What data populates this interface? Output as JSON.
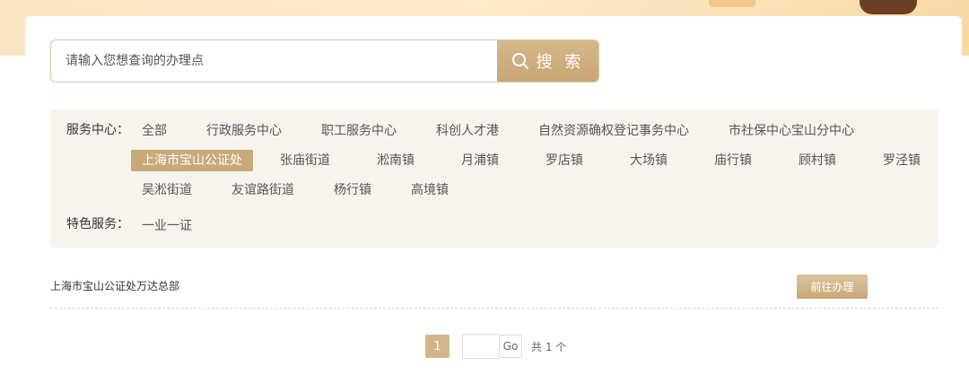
{
  "search": {
    "placeholder": "请输入您想查询的办理点",
    "button_label": "搜 索"
  },
  "filters": {
    "service_center": {
      "label": "服务中心：",
      "rows": [
        [
          "全部",
          "行政服务中心",
          "职工服务中心",
          "科创人才港",
          "自然资源确权登记事务中心",
          "市社保中心宝山分中心"
        ],
        [
          "上海市宝山公证处",
          "张庙街道",
          "淞南镇",
          "月浦镇",
          "罗店镇",
          "大场镇",
          "庙行镇",
          "顾村镇",
          "罗泾镇"
        ],
        [
          "吴淞街道",
          "友谊路街道",
          "杨行镇",
          "高境镇"
        ]
      ],
      "selected": "上海市宝山公证处"
    },
    "special_service": {
      "label": "特色服务：",
      "items": [
        "一业一证"
      ]
    }
  },
  "results": [
    {
      "name": "上海市宝山公证处万达总部",
      "action_label": "前往办理"
    }
  ],
  "pagination": {
    "current_page": "1",
    "go_label": "Go",
    "total_text": "共 1 个"
  },
  "colors": {
    "accent": "#c9a97a",
    "panel_bg": "#f7f4ee",
    "banner": "#fbe6c4"
  }
}
